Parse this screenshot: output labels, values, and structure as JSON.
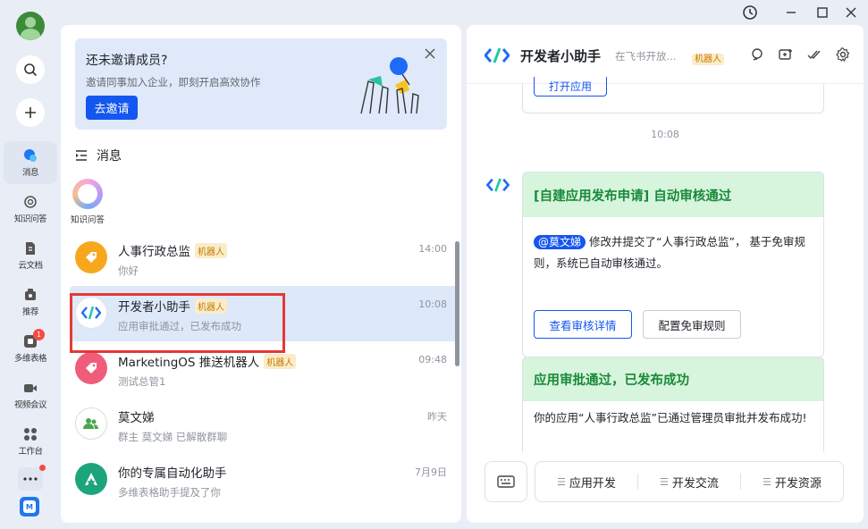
{
  "window": {
    "controls": [
      "history-icon",
      "minimize-icon",
      "maximize-icon",
      "close-icon"
    ]
  },
  "rail": {
    "items": [
      {
        "label": "消息",
        "icon": "chat-bubble-icon",
        "active": true
      },
      {
        "label": "知识问答",
        "icon": "knowledge-qa-icon"
      },
      {
        "label": "云文档",
        "icon": "cloud-doc-icon"
      },
      {
        "label": "推荐",
        "icon": "recommend-icon"
      },
      {
        "label": "多维表格",
        "icon": "base-table-icon",
        "badge": "1"
      },
      {
        "label": "视频会议",
        "icon": "video-meeting-icon"
      },
      {
        "label": "工作台",
        "icon": "workplace-icon"
      }
    ]
  },
  "invite": {
    "title": "还未邀请成员?",
    "desc": "邀请同事加入企业，即刻开启高效协作",
    "button": "去邀请"
  },
  "messages": {
    "header": "消息",
    "pinned_label": "知识问答",
    "rows": [
      {
        "name": "人事行政总监",
        "tag": "机器人",
        "time": "14:00",
        "preview": "你好",
        "color": "#f7a71c"
      },
      {
        "name": "开发者小助手",
        "tag": "机器人",
        "time": "10:08",
        "preview": "应用审批通过，已发布成功",
        "selected": true
      },
      {
        "name": "MarketingOS 推送机器人",
        "tag": "机器人",
        "time": "09:48",
        "preview": "测试总管1",
        "color": "#f05d7a"
      },
      {
        "name": "莫文娣",
        "tag": "",
        "time": "昨天",
        "preview": "群主 莫文娣 已解散群聊",
        "color": "#4ba649"
      },
      {
        "name": "你的专属自动化助手",
        "tag": "",
        "time": "7月9日",
        "preview": "多维表格助手提及了你",
        "color": "#1ca57a"
      }
    ]
  },
  "chat": {
    "title": "开发者小助手",
    "subtitle": "在飞书开放...",
    "tag": "机器人",
    "prev_button": "打开应用",
    "timestamp": "10:08",
    "card1": {
      "header": "[自建应用发布申请] 自动审核通过",
      "mention": "@莫文娣",
      "body": "修改并提交了“人事行政总监”， 基于免审规则，系统已自动审核通过。",
      "btn_primary": "查看审核详情",
      "btn_secondary": "配置免审规则"
    },
    "card2": {
      "header": "应用审批通过，已发布成功",
      "body": "你的应用“人事行政总监”已通过管理员审批并发布成功!"
    },
    "menu": [
      "应用开发",
      "开发交流",
      "开发资源"
    ]
  }
}
